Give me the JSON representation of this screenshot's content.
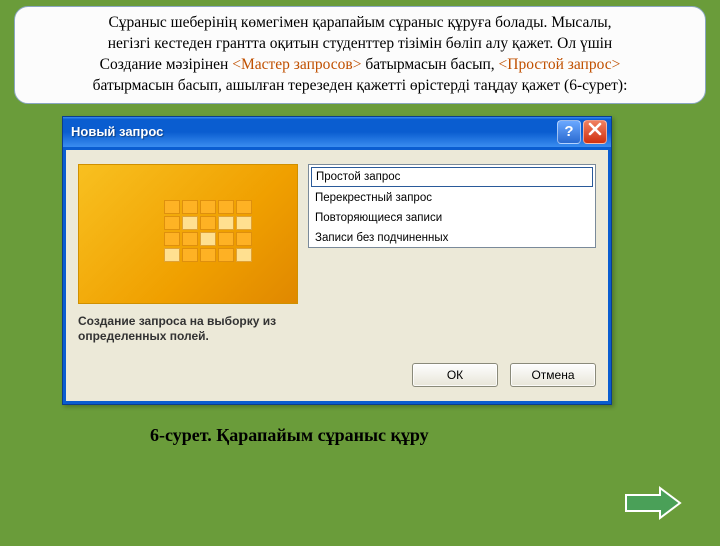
{
  "instruction": {
    "t1": "Сұраныс шеберінің көмегімен қарапайым сұраныс құруға болады. Мысалы,",
    "t2": "негізгі кестеден грантта оқитын студенттер тізімін бөліп алу қажет. Ол үшін",
    "t3a": "Создание мәзірінен ",
    "hl1": "<Мастер запросов>",
    "t3b": " батырмасын басып, ",
    "hl2": "<Простой запрос>",
    "t4": "батырмасын басып, ашылған терезеден қажетті өрістерді таңдау қажет (6-сурет):"
  },
  "dialog": {
    "title": "Новый запрос",
    "options": [
      "Простой запрос",
      "Перекрестный запрос",
      "Повторяющиеся записи",
      "Записи без подчиненных"
    ],
    "description": "Создание запроса на выборку из определенных полей.",
    "ok": "ОК",
    "cancel": "Отмена"
  },
  "caption": "6-сурет. Қарапайым сұраныс құру"
}
